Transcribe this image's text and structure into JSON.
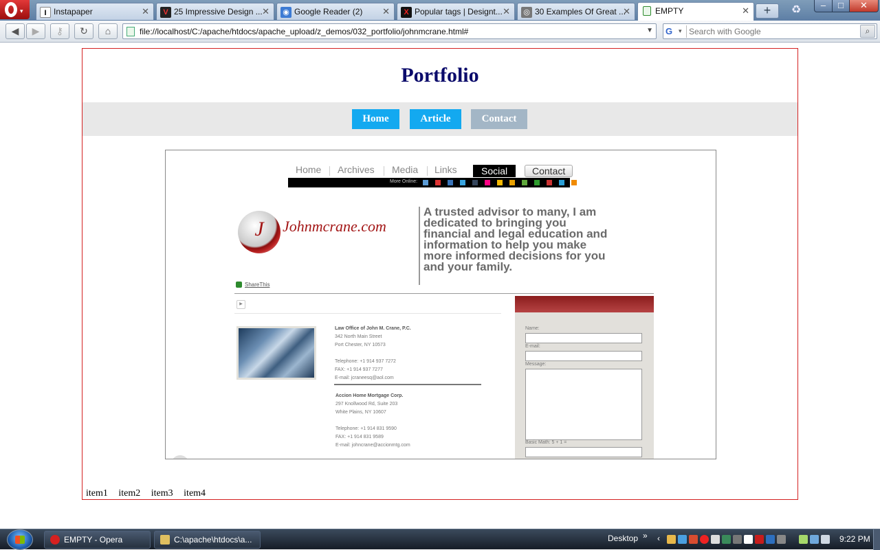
{
  "browser": {
    "tabs": [
      {
        "title": "Instapaper",
        "icon": "instapaper-icon",
        "color": "#ffffff",
        "glyph": "I"
      },
      {
        "title": "25 Impressive Design ...",
        "icon": "v-icon",
        "color": "#222222",
        "glyph": "V"
      },
      {
        "title": "Google Reader (2)",
        "icon": "rss-icon",
        "color": "#3c7bd4",
        "glyph": "◉"
      },
      {
        "title": "Popular tags | Designt...",
        "icon": "x-icon",
        "color": "#111111",
        "glyph": "X"
      },
      {
        "title": "30 Examples Of Great ...",
        "icon": "owl-icon",
        "color": "#777777",
        "glyph": "◎"
      },
      {
        "title": "EMPTY",
        "icon": "page-icon",
        "color": "#2d8a2d",
        "glyph": ""
      }
    ],
    "new_tab_glyph": "+",
    "back_glyph": "◀",
    "forward_glyph": "▶",
    "key_glyph": "⚷",
    "reload_glyph": "↻",
    "home_glyph": "⌂",
    "address": "file://localhost/C:/apache/htdocs/apache_upload/z_demos/032_portfolio/johnmcrane.html#",
    "search_placeholder": "Search with Google",
    "window_controls": {
      "minimize": "–",
      "maximize": "□",
      "close": "✕"
    }
  },
  "page": {
    "title": "Portfolio",
    "nav": [
      {
        "label": "Home",
        "color": "#13a9f0"
      },
      {
        "label": "Article",
        "color": "#13a9f0"
      },
      {
        "label": "Contact",
        "color": "#a3b6c6"
      }
    ],
    "screenshot": {
      "nav": [
        "Home",
        "Archives",
        "Media",
        "Links",
        "Social",
        "Contact"
      ],
      "more_online": "More Online:",
      "logo_text": "Johnmcrane.com",
      "seal_letter": "J",
      "tagline": "A trusted advisor to many, I am dedicated to bringing you financial and legal education and information to help you make more informed decisions for you and your family.",
      "sharethis": "ShareThis",
      "office1": {
        "name": "Law Office of John M. Crane, P.C.",
        "street": "342 North Main Street",
        "city": "Port Chester, NY 10573",
        "tel": "Telephone: +1 914 937 7272",
        "fax": "FAX: +1 914 937 7277",
        "email": "E-mail: jcraneesq@aol.com"
      },
      "office2": {
        "name": "Accion Home Mortgage Corp.",
        "street": "297 Knollwood Rd, Suite 203",
        "city": "White Plains, NY 10607",
        "tel": "Telephone: +1 914 831 9590",
        "fax": "FAX: +1 914 831 9589",
        "email": "E-mail: johncrane@accionmtg.com"
      },
      "form": {
        "name_label": "Name:",
        "email_label": "E-mail:",
        "message_label": "Message:",
        "math_label": "Basic Math: 5 + 1 ="
      }
    },
    "items": [
      "item1",
      "item2",
      "item3",
      "item4"
    ]
  },
  "taskbar": {
    "windows": [
      {
        "label": "EMPTY - Opera",
        "icon": "opera-icon",
        "color": "#d62020"
      },
      {
        "label": "C:\\apache\\htdocs\\a...",
        "icon": "notepad-icon",
        "color": "#e0c060"
      }
    ],
    "desktop_label": "Desktop",
    "desktop_chevron": "»",
    "tray_chevron": "‹",
    "clock": "9:22 PM"
  },
  "colors": {
    "page_title": "#0b0b6b",
    "frame_border": "#d32020",
    "nav_active": "#13a9f0",
    "nav_inactive": "#a3b6c6"
  }
}
